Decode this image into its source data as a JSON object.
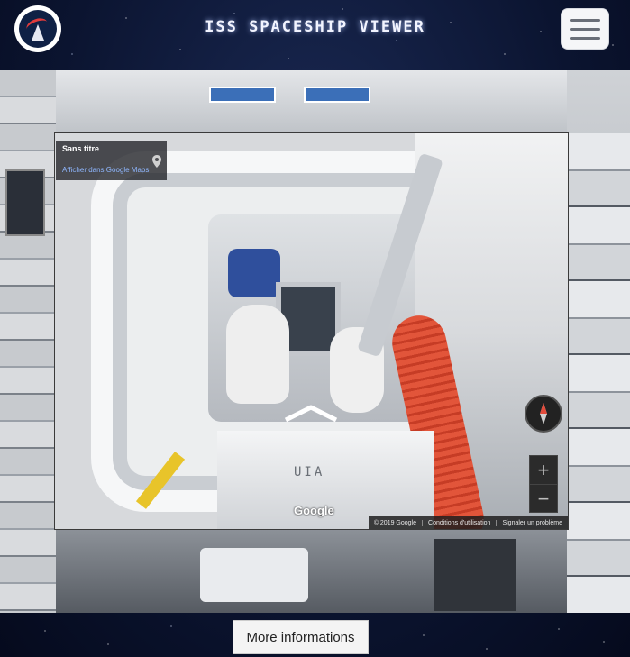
{
  "header": {
    "title": "ISS SPACESHIP VIEWER",
    "logo_icon": "mission-patch-logo",
    "menu_icon": "hamburger-icon"
  },
  "viewer": {
    "info_title": "Sans titre",
    "info_link": "Afficher dans Google Maps",
    "pin_icon": "map-pin-icon",
    "scene_text": "UIA",
    "google_label": "Google",
    "zoom_in": "+",
    "zoom_out": "−",
    "footer": {
      "copyright": "© 2019 Google",
      "terms": "Conditions d'utilisation",
      "report": "Signaler un problème"
    }
  },
  "actions": {
    "more_info": "More informations"
  },
  "colors": {
    "page_bg": "#0b1430",
    "link": "#8fb7ff",
    "hose": "#e2553a"
  }
}
